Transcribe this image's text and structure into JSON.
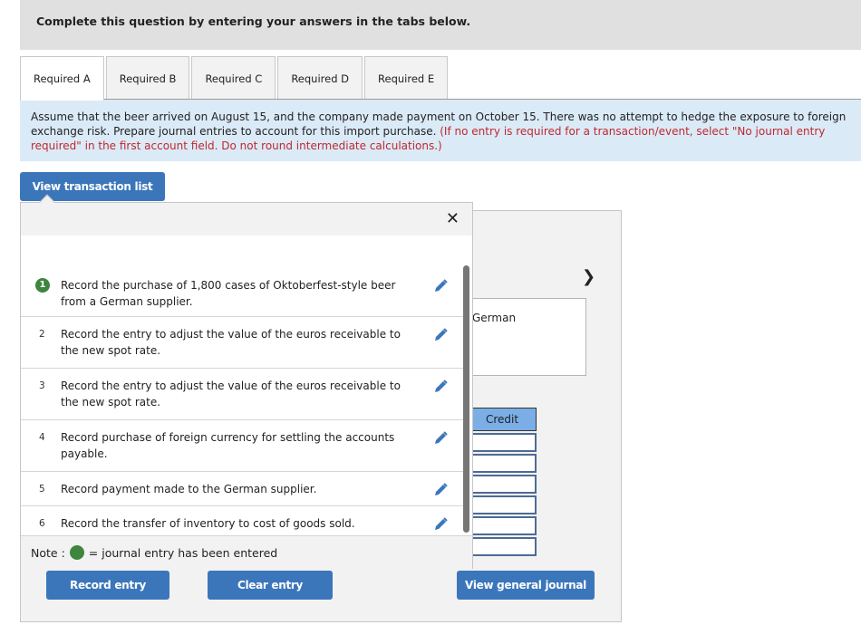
{
  "header": {
    "text": "Complete this question by entering your answers in the tabs below."
  },
  "tabs": [
    {
      "label": "Required A",
      "active": true
    },
    {
      "label": "Required B",
      "active": false
    },
    {
      "label": "Required C",
      "active": false
    },
    {
      "label": "Required D",
      "active": false
    },
    {
      "label": "Required E",
      "active": false
    }
  ],
  "instructions": {
    "text": "Assume that the beer arrived on August 15, and the company made payment on October 15. There was no attempt to hedge the exposure to foreign exchange risk. Prepare journal entries to account for this import purchase.",
    "note": "(If no entry is required for a transaction/event, select \"No journal entry required\" in the first account field. Do not round intermediate calculations.)"
  },
  "buttons": {
    "view_transaction_list": "View transaction list",
    "record_entry": "Record entry",
    "clear_entry": "Clear entry",
    "view_general_journal": "View general journal"
  },
  "journal": {
    "description_partial": "German",
    "credit_header": "Credit",
    "next_icon": "chevron-right-icon"
  },
  "transactions": [
    {
      "num": "1",
      "text": "Record the purchase of 1,800 cases of Oktoberfest-style beer from a German supplier.",
      "entered": true
    },
    {
      "num": "2",
      "text": "Record the entry to adjust the value of the euros receivable to the new spot rate.",
      "entered": false
    },
    {
      "num": "3",
      "text": "Record the entry to adjust the value of the euros receivable to the new spot rate.",
      "entered": false
    },
    {
      "num": "4",
      "text": "Record purchase of foreign currency for settling the accounts payable.",
      "entered": false
    },
    {
      "num": "5",
      "text": "Record payment made to the German supplier.",
      "entered": false
    },
    {
      "num": "6",
      "text": "Record the transfer of inventory to cost of goods sold.",
      "entered": false
    }
  ],
  "note": {
    "prefix": "Note :",
    "suffix": "= journal entry has been entered"
  },
  "colors": {
    "button": "#3b76bb",
    "entered_badge": "#3e8540",
    "instructions_bg": "#dbeaf7",
    "instruction_note": "#c0282d",
    "credit_header": "#7baee6"
  }
}
